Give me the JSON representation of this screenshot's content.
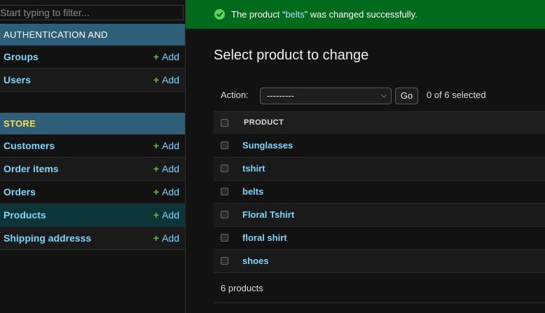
{
  "sidebar": {
    "filter_placeholder": "Start typing to filter...",
    "modules": [
      {
        "name": "AUTHENTICATION AND AUTHORIZATION",
        "models": [
          {
            "label": "Groups",
            "add": "Add"
          },
          {
            "label": "Users",
            "add": "Add"
          }
        ]
      },
      {
        "name": "STORE",
        "models": [
          {
            "label": "Customers",
            "add": "Add"
          },
          {
            "label": "Order items",
            "add": "Add"
          },
          {
            "label": "Orders",
            "add": "Add"
          },
          {
            "label": "Products",
            "add": "Add",
            "active": true
          },
          {
            "label": "Shipping addresss",
            "add": "Add"
          }
        ]
      }
    ],
    "plus_glyph": "+"
  },
  "message": {
    "prefix": "The product “",
    "link": "belts",
    "suffix": "” was changed successfully.",
    "color": "#006b1b"
  },
  "main": {
    "title": "Select product to change",
    "action_label": "Action:",
    "action_selected": "---------",
    "go_label": "Go",
    "selected_count": "0 of 6 selected",
    "column_header": "PRODUCT",
    "rows": [
      "Sunglasses",
      "tshirt",
      "belts",
      "Floral Tshirt",
      "floral shirt",
      "shoes"
    ],
    "paginator": "6 products"
  },
  "colors": {
    "link": "#81d4fa",
    "module_header": "#2f5e78",
    "active_row": "#0b3538",
    "add_plus": "#70bf2b"
  }
}
